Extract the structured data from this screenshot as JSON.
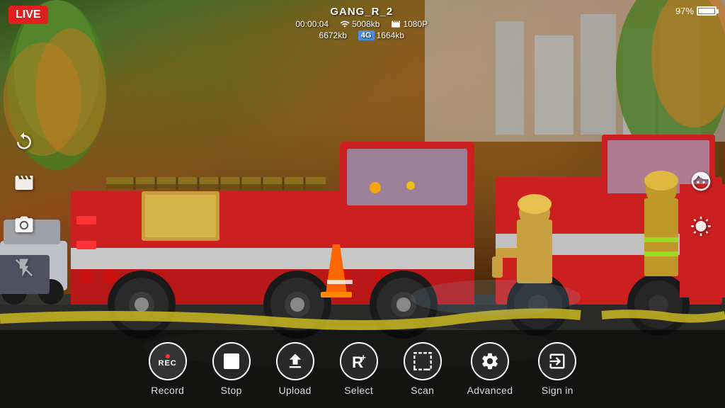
{
  "live_badge": "LIVE",
  "device_name": "GANG_R_2",
  "stats": {
    "time": "00:00:04",
    "wifi_label": "5008kb",
    "resolution_label": "1080P",
    "data_label": "6672kb",
    "lte_label": "4G",
    "lte_speed": "1664kb"
  },
  "battery_percent": "97%",
  "toolbar": {
    "record_label": "Record",
    "stop_label": "Stop",
    "upload_label": "Upload",
    "select_label": "Select",
    "scan_label": "Scan",
    "advanced_label": "Advanced",
    "signin_label": "Sign in"
  },
  "icons": {
    "camera_rotate": "↻",
    "film": "▤",
    "camera": "📷",
    "flash_off": "✗",
    "person_icon": "👤",
    "brightness": "☀",
    "wifi_icon": "wifi",
    "lte_icon": "4G"
  },
  "colors": {
    "live_red": "#e02020",
    "toolbar_bg": "rgba(0,0,0,0.55)",
    "accent": "#ffffff"
  }
}
